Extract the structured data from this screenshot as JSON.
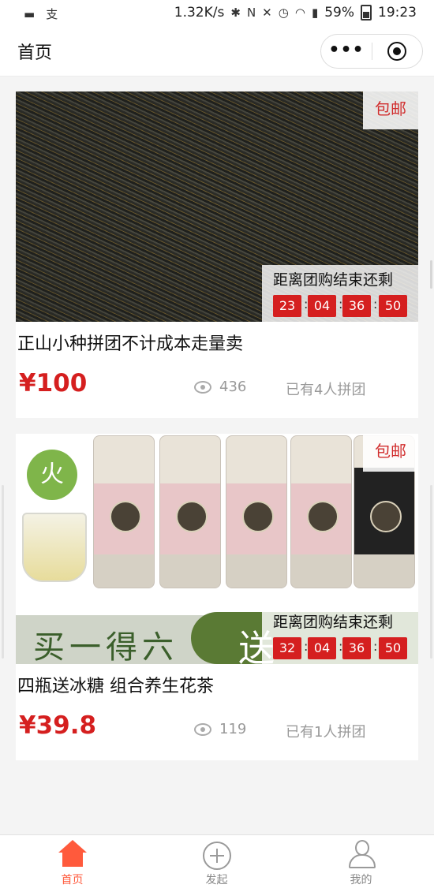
{
  "status_bar": {
    "net_speed": "1.32K/s",
    "battery": "59%",
    "time": "19:23",
    "left_icons": [
      "message-icon",
      "alipay-icon"
    ],
    "right_icons": [
      "bluetooth-icon",
      "nfc-icon",
      "mute-icon",
      "alarm-icon",
      "wifi-icon",
      "signal-icon",
      "battery-icon"
    ]
  },
  "nav": {
    "title": "首页",
    "more_icon": "more-dots-icon",
    "close_icon": "target-icon"
  },
  "products": [
    {
      "ship_tag": "包邮",
      "countdown_title": "距离团购结束还剩",
      "countdown": [
        "23",
        "04",
        "36",
        "50"
      ],
      "title": "正山小种拼团不计成本走量卖",
      "price": "¥100",
      "views": "436",
      "joined": "已有4人拼团",
      "image": "black-tea-leaves-photo"
    },
    {
      "ship_tag": "包邮",
      "countdown_title": "距离团购结束还剩",
      "countdown": [
        "32",
        "04",
        "36",
        "50"
      ],
      "title": "四瓶送冰糖 组合养生花茶",
      "price": "¥39.8",
      "views": "119",
      "joined": "已有1人拼团",
      "image": "flower-tea-jars-photo",
      "image_text": {
        "badge": "火",
        "banner": "买一得六",
        "banner_right": "送"
      }
    }
  ],
  "tabbar": {
    "tabs": [
      {
        "label": "首页",
        "icon": "home-icon",
        "active": true
      },
      {
        "label": "发起",
        "icon": "plus-circle-icon",
        "active": false
      },
      {
        "label": "我的",
        "icon": "user-icon",
        "active": false
      }
    ],
    "active_color": "#ff5a3c"
  },
  "colors": {
    "price_red": "#d51f1f",
    "countdown_red": "#d51f1f",
    "ship_tag_red": "#d12d2d"
  }
}
